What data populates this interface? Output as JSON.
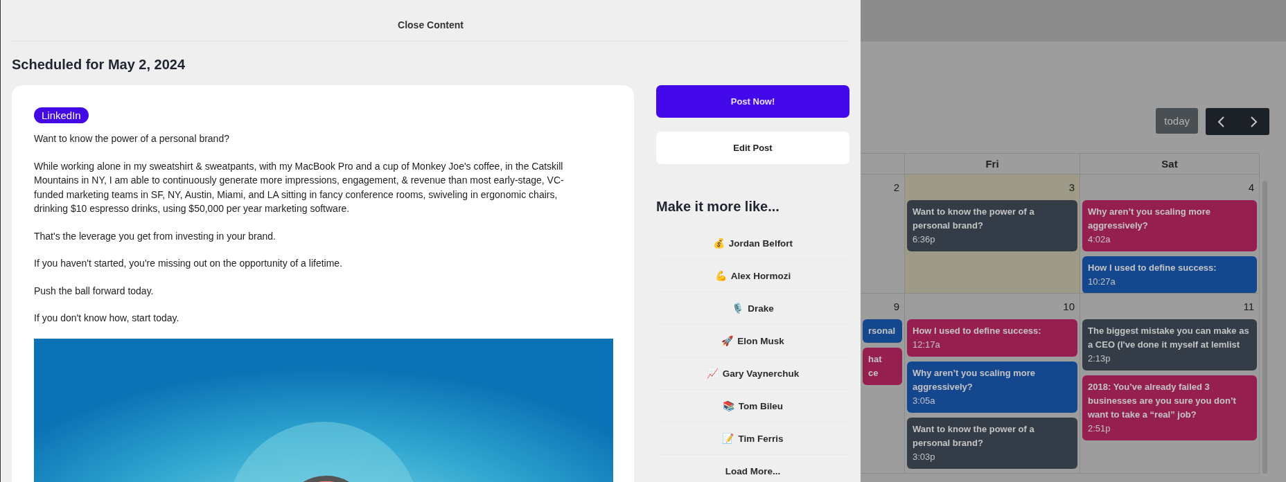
{
  "drawer": {
    "close_label": "Close Content",
    "title": "Scheduled for May 2, 2024",
    "post": {
      "platform": "LinkedIn",
      "paragraphs": [
        "Want to know the power of a personal brand?",
        "While working alone in my sweatshirt & sweatpants, with my MacBook Pro and a cup of Monkey Joe's coffee, in the Catskill Mountains in NY, I am able to continuously generate more impressions, engagement, & revenue than most early-stage, VC-funded marketing teams in SF, NY, Austin, Miami, and LA sitting in fancy conference rooms, swiveling in ergonomic chairs, drinking $10 espresso drinks, using $50,000 per year marketing software.",
        "That's the leverage you get from investing in your brand.",
        "If you haven't started, you're missing out on the opportunity of a lifetime.",
        "Push the ball forward today.",
        "If you don't know how, start today."
      ],
      "image": {
        "kind": "picture"
      }
    },
    "actions": [
      {
        "label": "Post Now!",
        "kind": "primary"
      },
      {
        "label": "Edit Post",
        "kind": "secondary"
      }
    ],
    "styles_heading": "Make it more like...",
    "styles": [
      {
        "icon": "💰",
        "name": "Jordan Belfort"
      },
      {
        "icon": "💪",
        "name": "Alex Hormozi"
      },
      {
        "icon": "🎙️",
        "name": "Drake"
      },
      {
        "icon": "🚀",
        "name": "Elon Musk"
      },
      {
        "icon": "📈",
        "name": "Gary Vaynerchuk"
      },
      {
        "icon": "📚",
        "name": "Tom Bileu"
      },
      {
        "icon": "📝",
        "name": "Tim Ferris"
      }
    ],
    "load_more": "Load More..."
  },
  "calendar": {
    "today_button": "today",
    "columns": [
      {
        "label": "Fri"
      },
      {
        "label": "Sat"
      }
    ],
    "weeks": [
      {
        "days": [
          {
            "number": "2",
            "today": false
          },
          {
            "number": "3",
            "today": true,
            "events": [
              {
                "lines": [
                  "Want to know the power of a personal brand?"
                ],
                "time": "6:36p",
                "color": "#343c47"
              }
            ]
          },
          {
            "number": "4",
            "today": false,
            "events": [
              {
                "lines": [
                  "Why aren’t you scaling more aggressively?"
                ],
                "time": "4:02a",
                "color": "#952050"
              },
              {
                "lines": [
                  "How I used to define success:"
                ],
                "time": "10:27a",
                "color": "#15478f"
              }
            ]
          }
        ]
      },
      {
        "days": [
          {
            "number": "9",
            "today": false,
            "events": [
              {
                "lines": [
                  "rsonal"
                ],
                "color": "#15478f"
              },
              {
                "lines": [
                  "hat",
                  "ce"
                ],
                "color": "#952050"
              }
            ]
          },
          {
            "number": "10",
            "today": false,
            "events": [
              {
                "lines": [
                  "How I used to define success:"
                ],
                "time": "12:17a",
                "color": "#952050"
              },
              {
                "lines": [
                  "Why aren’t you scaling more aggressively?"
                ],
                "time": "3:05a",
                "color": "#15478f"
              },
              {
                "lines": [
                  "Want to know the power of a personal brand?"
                ],
                "time": "3:03p",
                "color": "#343c47"
              }
            ]
          },
          {
            "number": "11",
            "today": false,
            "events": [
              {
                "lines": [
                  "The biggest mistake you can make as a CEO (I've done it myself at lemlist"
                ],
                "time": "2:13p",
                "color": "#343c47"
              },
              {
                "lines": [
                  "2018: You’ve already failed 3 businesses are you sure you don’t want to take a “real” job?"
                ],
                "time": "2:51p",
                "color": "#952050"
              }
            ]
          }
        ]
      }
    ]
  }
}
